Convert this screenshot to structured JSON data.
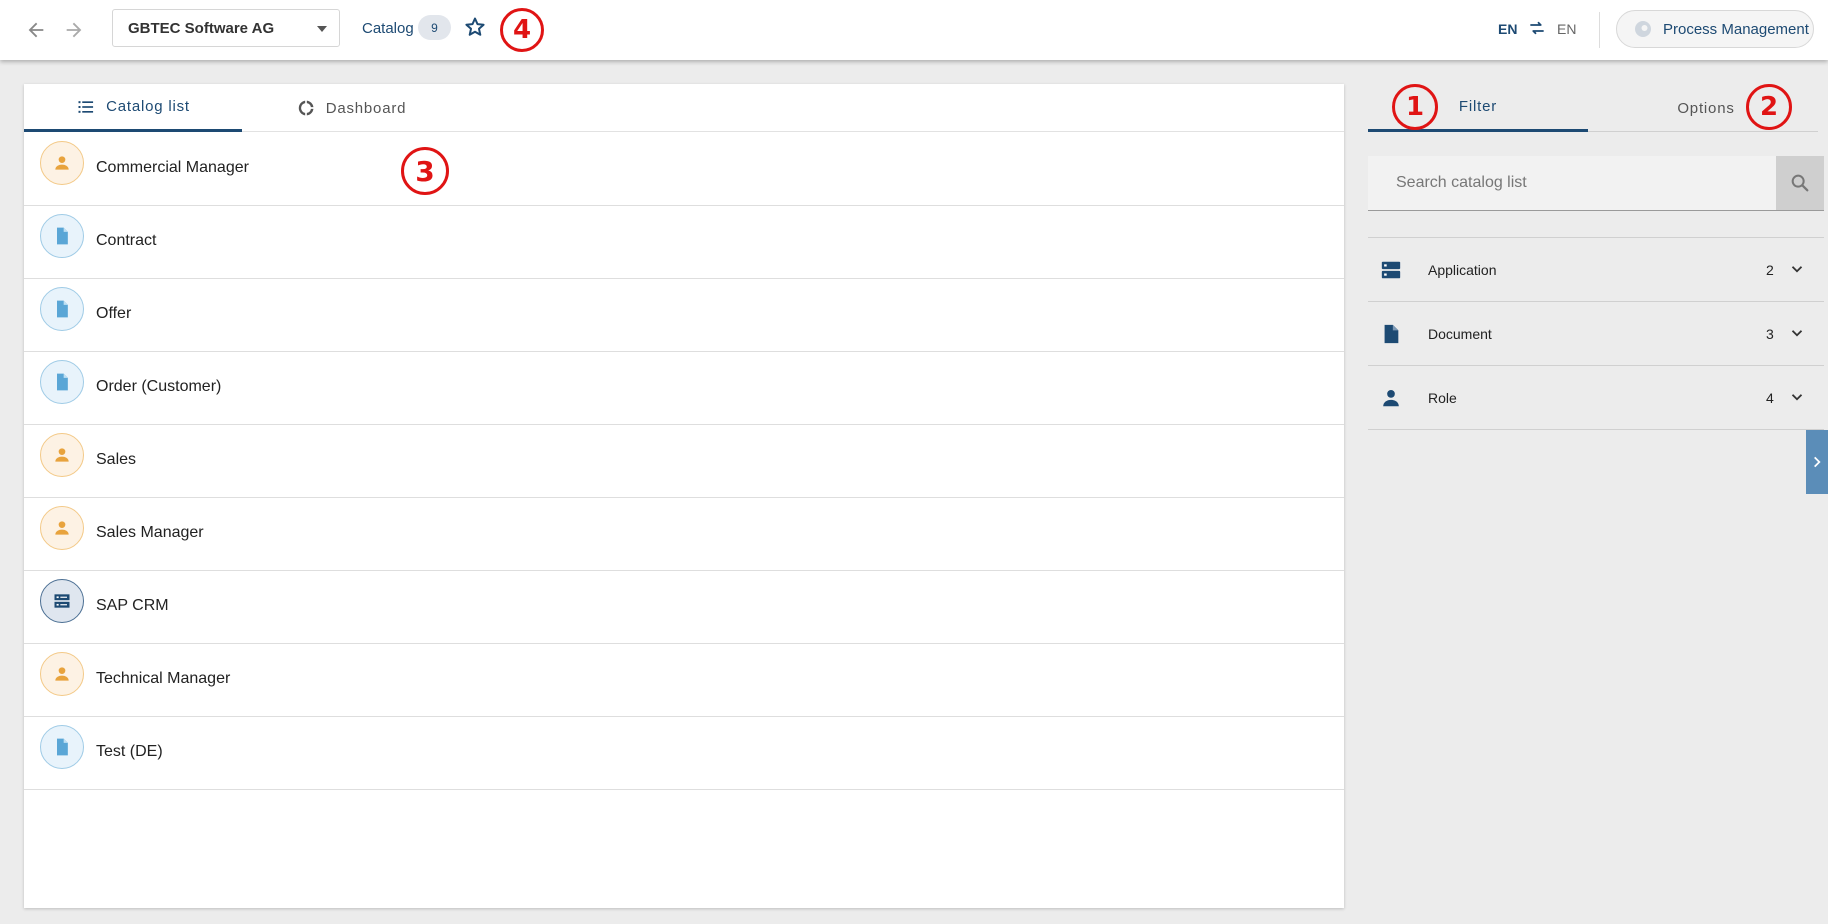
{
  "topbar": {
    "back_icon": "arrow-left-icon",
    "forward_icon": "arrow-right-icon",
    "company": "GBTEC Software AG",
    "catalog_label": "Catalog",
    "catalog_count": "9",
    "favorite_icon": "star-outline-icon",
    "lang_from": "EN",
    "lang_swap_icon": "swap-icon",
    "lang_to": "EN",
    "process_management_label": "Process Management"
  },
  "markers": {
    "m1": "1",
    "m2": "2",
    "m3": "3",
    "m4": "4"
  },
  "main": {
    "tabs": [
      {
        "label": "Catalog list",
        "icon": "list-icon",
        "active": true
      },
      {
        "label": "Dashboard",
        "icon": "dashboard-ring-icon",
        "active": false
      }
    ],
    "items": [
      {
        "label": "Commercial Manager",
        "type": "role"
      },
      {
        "label": "Contract",
        "type": "document"
      },
      {
        "label": "Offer",
        "type": "document"
      },
      {
        "label": "Order (Customer)",
        "type": "document"
      },
      {
        "label": "Sales",
        "type": "role"
      },
      {
        "label": "Sales Manager",
        "type": "role"
      },
      {
        "label": "SAP CRM",
        "type": "application"
      },
      {
        "label": "Technical Manager",
        "type": "role"
      },
      {
        "label": "Test (DE)",
        "type": "document"
      }
    ]
  },
  "side": {
    "tabs": [
      {
        "label": "Filter",
        "active": true
      },
      {
        "label": "Options",
        "active": false
      }
    ],
    "search": {
      "placeholder": "Search catalog list",
      "value": ""
    },
    "filters": [
      {
        "label": "Application",
        "count": "2",
        "icon": "application-icon"
      },
      {
        "label": "Document",
        "count": "3",
        "icon": "document-icon"
      },
      {
        "label": "Role",
        "count": "4",
        "icon": "person-icon"
      }
    ]
  },
  "colors": {
    "primary": "#1d4a73",
    "role_accent": "#e8a33d",
    "document_accent": "#5aa6d6",
    "application_accent": "#1d4a73",
    "annotation_red": "#e01414",
    "side_toggle": "#5b8db8"
  }
}
